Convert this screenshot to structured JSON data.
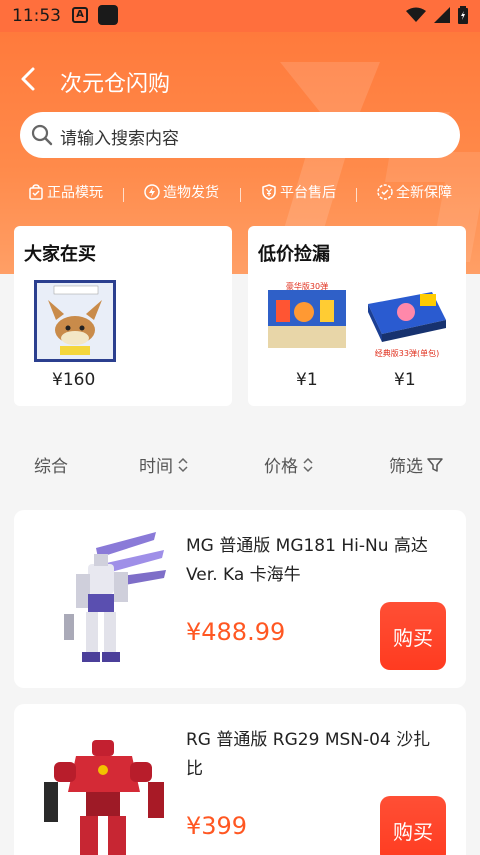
{
  "status_bar": {
    "time": "11:53",
    "a_icon": "A"
  },
  "header": {
    "title": "次元仓闪购"
  },
  "search": {
    "placeholder": "请输入搜索内容"
  },
  "features": [
    {
      "label": "正品模玩",
      "icon": "bag-check-icon"
    },
    {
      "label": "造物发货",
      "icon": "lightning-icon"
    },
    {
      "label": "平台售后",
      "icon": "shield-yen-icon"
    },
    {
      "label": "全新保障",
      "icon": "badge-icon"
    }
  ],
  "cards": {
    "buying": {
      "title": "大家在买",
      "items": [
        {
          "price": "¥160"
        }
      ]
    },
    "deals": {
      "title": "低价捡漏",
      "items": [
        {
          "price": "¥1",
          "img_text": "豪华版30弹"
        },
        {
          "price": "¥1",
          "img_text": "经典版33弹(单包)"
        }
      ]
    }
  },
  "filter": {
    "composite": "综合",
    "time": "时间",
    "price": "价格",
    "filter": "筛选"
  },
  "products": [
    {
      "name": "MG 普通版 MG181 Hi-Nu 高达 Ver. Ka 卡海牛",
      "price": "¥488.99",
      "buy": "购买"
    },
    {
      "name": "RG 普通版 RG29 MSN-04 沙扎比",
      "price": "¥399",
      "buy": "购买"
    }
  ],
  "colors": {
    "accent": "#ff6f3d",
    "price": "#ff5722",
    "buy": "#ff4328"
  }
}
